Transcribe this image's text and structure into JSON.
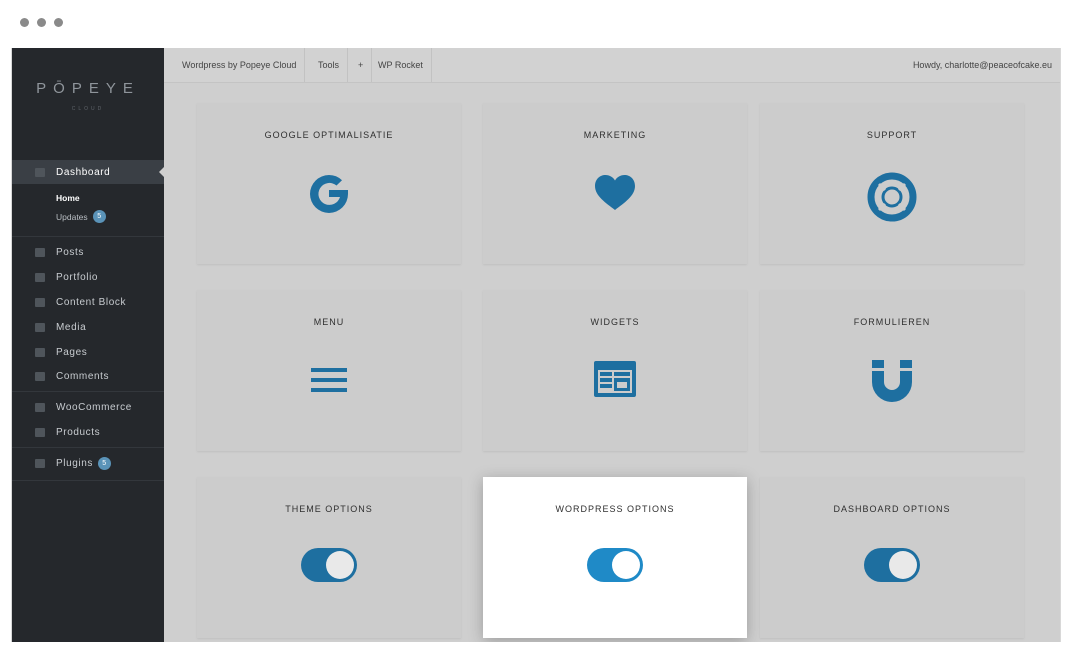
{
  "window": {
    "controls": [
      "dot-1",
      "dot-2",
      "dot-3"
    ]
  },
  "brand": {
    "logo": "PŌPEYE",
    "logo_sub": "CLOUD"
  },
  "sidebar": {
    "active": "Dashboard",
    "dashboard": {
      "label": "Dashboard",
      "icon": "dashboard-icon"
    },
    "dashboard_sub": [
      {
        "label": "Home",
        "current": true
      },
      {
        "label": "Updates",
        "badge": "5"
      }
    ],
    "items": [
      {
        "label": "Posts",
        "icon": "pin-icon"
      },
      {
        "label": "Portfolio",
        "icon": "portfolio-icon"
      },
      {
        "label": "Content Block",
        "icon": "content-block-icon"
      },
      {
        "label": "Media",
        "icon": "media-icon"
      },
      {
        "label": "Pages",
        "icon": "pages-icon"
      },
      {
        "label": "Comments",
        "icon": "comments-icon"
      },
      {
        "label": "WooCommerce",
        "icon": "woocommerce-icon"
      },
      {
        "label": "Products",
        "icon": "products-icon"
      },
      {
        "label": "Plugins",
        "icon": "plugins-icon",
        "badge": "5"
      }
    ]
  },
  "topbar": {
    "items": [
      "Wordpress by Popeye Cloud",
      "Tools",
      "+",
      "WP Rocket"
    ],
    "user": "Howdy, charlotte@peaceofcake.eu"
  },
  "tiles": [
    {
      "title": "GOOGLE OPTIMALISATIE",
      "icon": "google-icon"
    },
    {
      "title": "MARKETING",
      "icon": "heart-icon"
    },
    {
      "title": "SUPPORT",
      "icon": "lifebuoy-icon"
    },
    {
      "title": "MENU",
      "icon": "menu-icon"
    },
    {
      "title": "WIDGETS",
      "icon": "widgets-icon"
    },
    {
      "title": "FORMULIEREN",
      "icon": "magnet-icon"
    },
    {
      "title": "THEME OPTIONS",
      "icon": "toggle-icon"
    },
    {
      "title": "WORDPRESS OPTIONS",
      "icon": "toggle-icon",
      "highlighted": true
    },
    {
      "title": "DASHBOARD OPTIONS",
      "icon": "toggle-icon"
    }
  ],
  "colors": {
    "accent": "#1e6fa0",
    "sidebar_bg": "#25282c",
    "content_bg": "#cfcfcf",
    "highlight_toggle": "#1f8ac7"
  }
}
